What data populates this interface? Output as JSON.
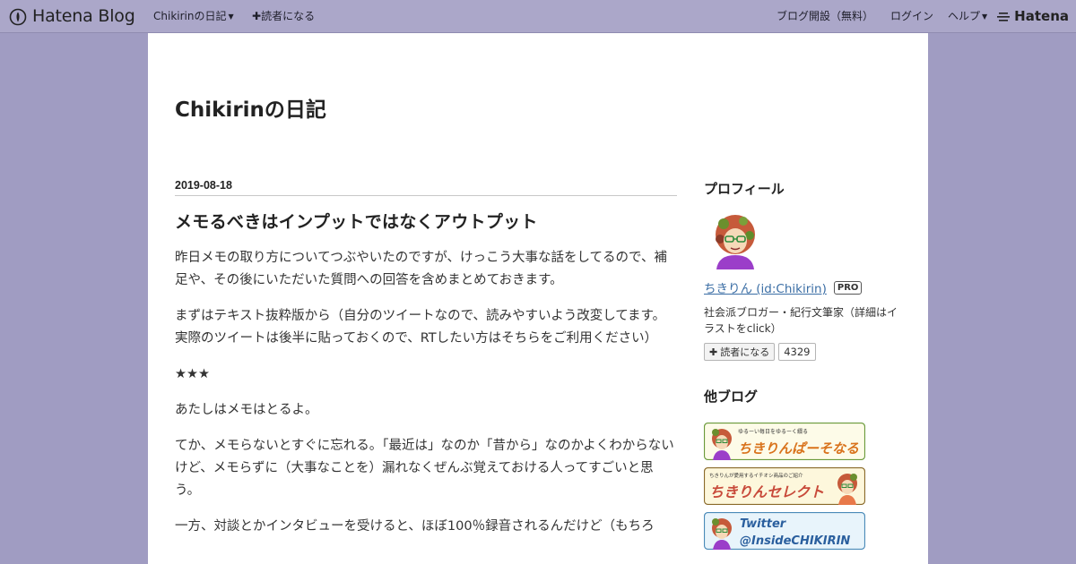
{
  "header": {
    "logo_text": "Hatena Blog",
    "blog_menu": "Chikirinの日記",
    "subscribe": "読者になる",
    "open_blog": "ブログ開設（無料）",
    "login": "ログイン",
    "help": "ヘルプ",
    "brand": "Hatena"
  },
  "blog": {
    "title": "Chikirinの日記"
  },
  "entry": {
    "date": "2019-08-18",
    "title": "メモるべきはインプットではなくアウトプット",
    "paragraphs": [
      "昨日メモの取り方についてつぶやいたのですが、けっこう大事な話をしてるので、補足や、その後にいただいた質問への回答を含めまとめておきます。",
      "まずはテキスト抜粋版から（自分のツイートなので、読みやすいよう改変してます。実際のツイートは後半に貼っておくので、RTしたい方はそちらをご利用ください）",
      "★★★",
      "あたしはメモはとるよ。",
      "てか、メモらないとすぐに忘れる。「最近は」なのか「昔から」なのかよくわからないけど、メモらずに（大事なことを）漏れなくぜんぶ覚えておける人ってすごいと思う。",
      "一方、対談とかインタビューを受けると、ほぼ100％録音されるんだけど（もちろ"
    ]
  },
  "sidebar": {
    "profile_heading": "プロフィール",
    "profile_link": "ちきりん (id:Chikirin)",
    "pro_badge": "PRO",
    "description": "社会派ブロガー・紀行文筆家（詳細はイラストをclick）",
    "subscribe_label": "読者になる",
    "subscriber_count": "4329",
    "other_blogs_heading": "他ブログ",
    "banners": [
      {
        "caption": "ゆるーい毎日をゆるーく綴る",
        "title": "ちきりんぱーそなる"
      },
      {
        "caption": "ちきりんが愛用するイチオシ商品のご紹介",
        "title": "ちきりんセレクト"
      },
      {
        "caption": "",
        "title_line1": "Twitter",
        "title_line2": "@InsideCHIKIRIN"
      }
    ]
  },
  "colors": {
    "background": "#a09cc2",
    "topbar": "#aba7c9",
    "link": "#3b6ea5",
    "banner_border": "#6a9a3a"
  }
}
